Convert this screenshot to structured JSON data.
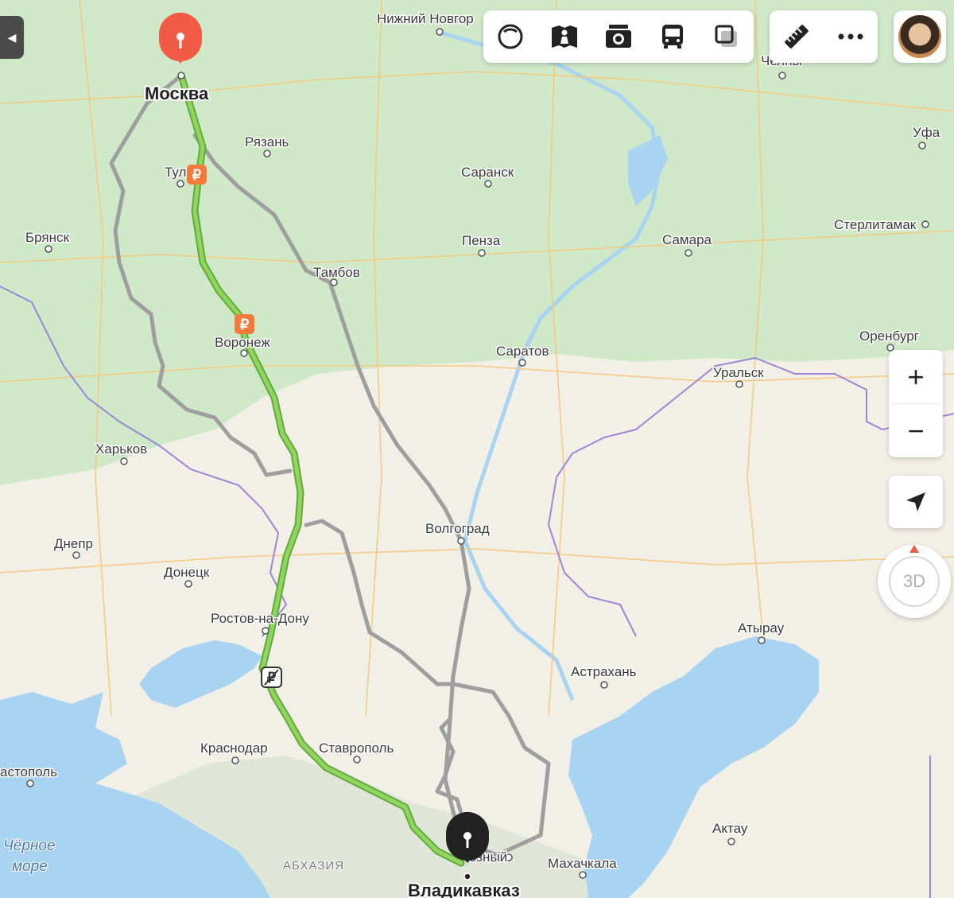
{
  "map": {
    "cities": [
      {
        "id": "moscow",
        "name": "Москва",
        "major": true
      },
      {
        "id": "nizhny",
        "name": "Нижний Новгор"
      },
      {
        "id": "chelny",
        "name": "Челны"
      },
      {
        "id": "ufa",
        "name": "Уфа"
      },
      {
        "id": "ryazan",
        "name": "Рязань"
      },
      {
        "id": "saransk",
        "name": "Саранск"
      },
      {
        "id": "tula",
        "name": "Тул"
      },
      {
        "id": "bryansk",
        "name": "Брянск"
      },
      {
        "id": "penza",
        "name": "Пенза"
      },
      {
        "id": "samara",
        "name": "Самара"
      },
      {
        "id": "sterlitamak",
        "name": "Стерлитамак"
      },
      {
        "id": "tambov",
        "name": "Тамбов"
      },
      {
        "id": "voronezh",
        "name": "Воронеж"
      },
      {
        "id": "orenburg",
        "name": "Оренбург"
      },
      {
        "id": "saratov",
        "name": "Саратов"
      },
      {
        "id": "uralsk",
        "name": "Уральск"
      },
      {
        "id": "kharkov",
        "name": "Харьков"
      },
      {
        "id": "volgograd",
        "name": "Волгоград"
      },
      {
        "id": "dnepr",
        "name": "Днепр"
      },
      {
        "id": "donetsk",
        "name": "Донецк"
      },
      {
        "id": "rostov",
        "name": "Ростов-на-Дону"
      },
      {
        "id": "atyrau",
        "name": "Атырау"
      },
      {
        "id": "astrakhan",
        "name": "Астрахань"
      },
      {
        "id": "krasnodar",
        "name": "Краснодар"
      },
      {
        "id": "stavropol",
        "name": "Ставрополь"
      },
      {
        "id": "sevastopol",
        "name": "астополь"
      },
      {
        "id": "aktau",
        "name": "Актау"
      },
      {
        "id": "grozny",
        "name": "озный"
      },
      {
        "id": "makhachkala",
        "name": "Махачкала"
      },
      {
        "id": "vladikavkaz",
        "name": "Владикавказ",
        "major": true
      }
    ],
    "sea_label_line1": "Чёрное",
    "sea_label_line2": "море",
    "region_label": "АБХАЗИЯ",
    "toll_symbol": "₽",
    "route": {
      "from": "Москва",
      "to": "Владикавказ",
      "active_color": "#7ccb4e",
      "alt_color": "#9e9e9e",
      "start_pin_color": "#f15a45",
      "end_pin_color": "#222222"
    }
  },
  "toolbar": {
    "items": [
      "traffic-icon",
      "panorama-icon",
      "photo-icon",
      "transit-icon",
      "layers-icon"
    ]
  },
  "tools": {
    "items": [
      "ruler-icon",
      "more-icon"
    ]
  },
  "controls": {
    "zoom_in": "+",
    "zoom_out": "−",
    "three_d": "3D"
  },
  "colors": {
    "land": "#f2efe6",
    "forest": "#cfe8c8",
    "water": "#a8d4f2",
    "mountain": "#dfe6d8",
    "road": "#f5c77a",
    "border": "#9a86d6"
  }
}
